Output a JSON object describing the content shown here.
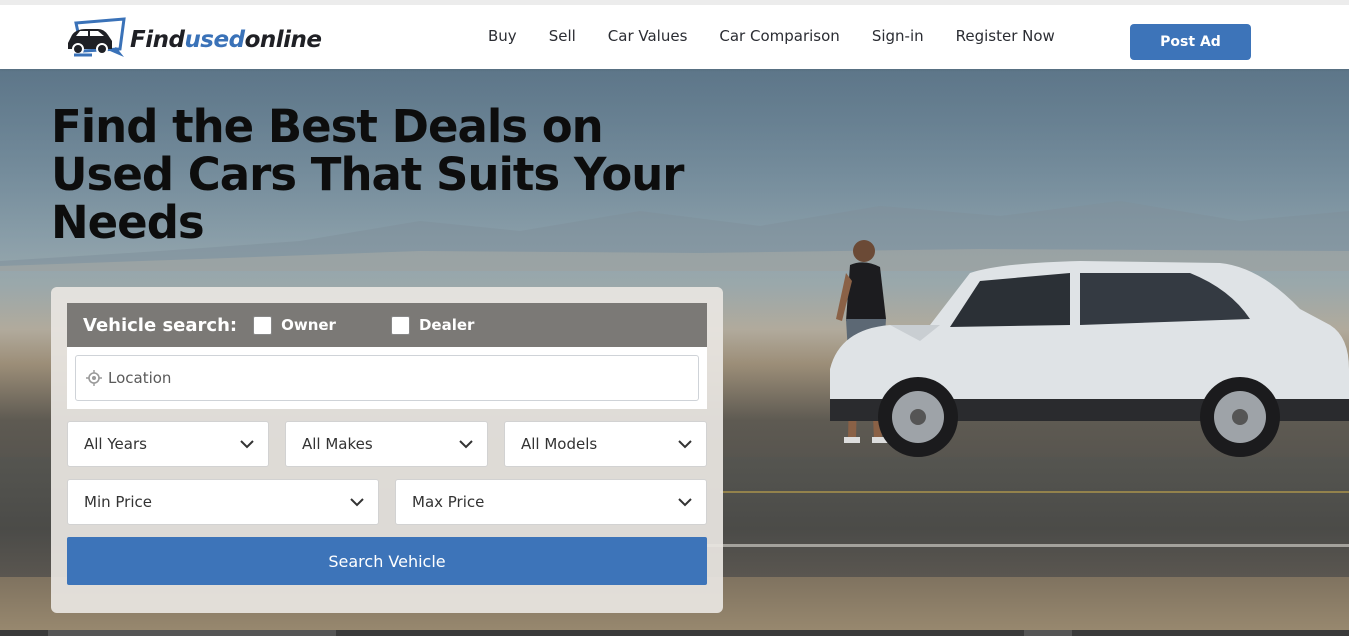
{
  "brand": {
    "logo_dark": "Find",
    "logo_blue": "used",
    "logo_dark2": "online",
    "accent_color": "#3d74b9"
  },
  "nav": {
    "items": [
      {
        "label": "Buy"
      },
      {
        "label": "Sell"
      },
      {
        "label": "Car Values"
      },
      {
        "label": "Car Comparison"
      },
      {
        "label": "Sign-in"
      },
      {
        "label": "Register Now"
      }
    ],
    "post_ad_label": "Post Ad"
  },
  "hero": {
    "headline": "Find the Best Deals on Used Cars That Suits Your Needs"
  },
  "search": {
    "title": "Vehicle search:",
    "owner_label": "Owner",
    "dealer_label": "Dealer",
    "location_placeholder": "Location",
    "years": "All Years",
    "makes": "All Makes",
    "models": "All Models",
    "min_price": "Min Price",
    "max_price": "Max Price",
    "button_label": "Search Vehicle"
  },
  "icons": {
    "location": "location-target-icon",
    "dropdown": "chevron-down-icon",
    "logo": "car-monitor-icon"
  }
}
